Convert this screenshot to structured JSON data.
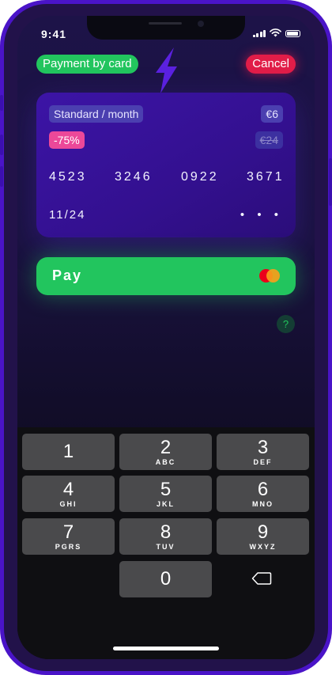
{
  "status_bar": {
    "time": "9:41"
  },
  "header": {
    "title": "Payment by card",
    "cancel_label": "Cancel"
  },
  "card": {
    "plan": "Standard / month",
    "price": "€6",
    "discount": "-75%",
    "old_price": "€24",
    "number_groups": [
      "4523",
      "3246",
      "0922",
      "3671"
    ],
    "expiry": "11/24",
    "cvc_mask": "• • •"
  },
  "pay_button": {
    "label": "Pay"
  },
  "help": {
    "label": "?"
  },
  "keypad": {
    "keys": [
      {
        "digit": "1",
        "letters": ""
      },
      {
        "digit": "2",
        "letters": "ABC"
      },
      {
        "digit": "3",
        "letters": "DEF"
      },
      {
        "digit": "4",
        "letters": "GHI"
      },
      {
        "digit": "5",
        "letters": "JKL"
      },
      {
        "digit": "6",
        "letters": "MNO"
      },
      {
        "digit": "7",
        "letters": "PGRS"
      },
      {
        "digit": "8",
        "letters": "TUV"
      },
      {
        "digit": "9",
        "letters": "WXYZ"
      },
      {
        "digit": "0",
        "letters": ""
      }
    ],
    "delete_icon": "backspace-icon"
  },
  "colors": {
    "accent_green": "#22c55e",
    "cancel_red": "#e11d48",
    "discount_pink": "#ec4899",
    "card_purple": "#3c14a6",
    "frame_purple": "#4a14c8"
  }
}
